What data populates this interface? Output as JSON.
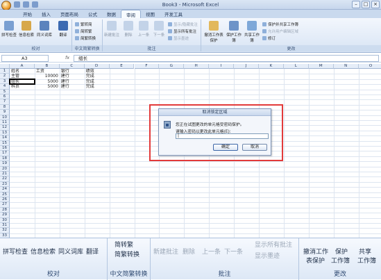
{
  "window": {
    "title": "Book3 - Microsoft Excel"
  },
  "tabs": [
    "开始",
    "插入",
    "页面布局",
    "公式",
    "数据",
    "审阅",
    "视图",
    "开发工具"
  ],
  "active_tab": "审阅",
  "ribbon": {
    "proofing": {
      "label": "校对",
      "buttons": [
        "拼写检查",
        "信息检索",
        "同义词库",
        "翻译"
      ]
    },
    "chinese": {
      "label": "中文简繁转换",
      "items": [
        "繁转简",
        "简转繁",
        "简繁转换"
      ]
    },
    "comments": {
      "label": "批注",
      "buttons": [
        "新建批注",
        "删除",
        "上一条",
        "下一条"
      ],
      "items": [
        "显示/隐藏批注",
        "显示所有批注",
        "显示墨迹"
      ]
    },
    "changes": {
      "label": "更改",
      "buttons": [
        "撤消工作表保护",
        "保护工作簿",
        "共享工作簿"
      ],
      "items": [
        "保护并共享工作簿",
        "允许用户编辑区域",
        "修订"
      ]
    }
  },
  "formula_bar": {
    "name_box": "A3",
    "fx": "fx",
    "value": "组长"
  },
  "columns": [
    "A",
    "B",
    "C",
    "D",
    "E",
    "F",
    "G",
    "H",
    "I",
    "J",
    "K",
    "L",
    "M",
    "N",
    "O"
  ],
  "rows": [
    "1",
    "2",
    "3",
    "4",
    "5",
    "6",
    "7",
    "8",
    "9",
    "10",
    "11",
    "12",
    "13",
    "14",
    "15",
    "16",
    "17",
    "18",
    "19",
    "20",
    "21",
    "22",
    "23",
    "24",
    "25",
    "26",
    "27",
    "28",
    "29",
    "30",
    "31",
    "32",
    "33"
  ],
  "cells": [
    [
      "姓名",
      "工资",
      "银行",
      "绩效"
    ],
    [
      "主管",
      "10000",
      "建行",
      "完成"
    ],
    [
      "组长",
      "5000",
      "建行",
      "完成"
    ],
    [
      "科员",
      "5000",
      "建行",
      "完成"
    ]
  ],
  "dialog": {
    "title": "取消锁定区域",
    "message": "您正在试图更改的单元格受密码保护。",
    "prompt": "请输入密码以更改此单元格(E):",
    "input_value": "|",
    "ok_label": "确定",
    "cancel_label": "取消"
  },
  "zoomed_ribbon": {
    "proofing_buttons": [
      "拼写检查",
      "信息检索",
      "同义词库",
      "翻译"
    ],
    "proofing_label": "校对",
    "chinese_items": [
      "简繁转换"
    ],
    "chinese_top": "简转繁",
    "chinese_label": "中文简繁转换",
    "comment_buttons": [
      "新建批注",
      "删除",
      "上一条",
      "下一条"
    ],
    "comment_items": [
      "显示所有批注",
      "显示墨迹"
    ],
    "comment_label": "批注",
    "change_top": [
      "撤消工作",
      "保护",
      "共享"
    ],
    "change_bottom": [
      "表保护",
      "工作簿",
      "工作簿"
    ],
    "change_label": "更改"
  }
}
